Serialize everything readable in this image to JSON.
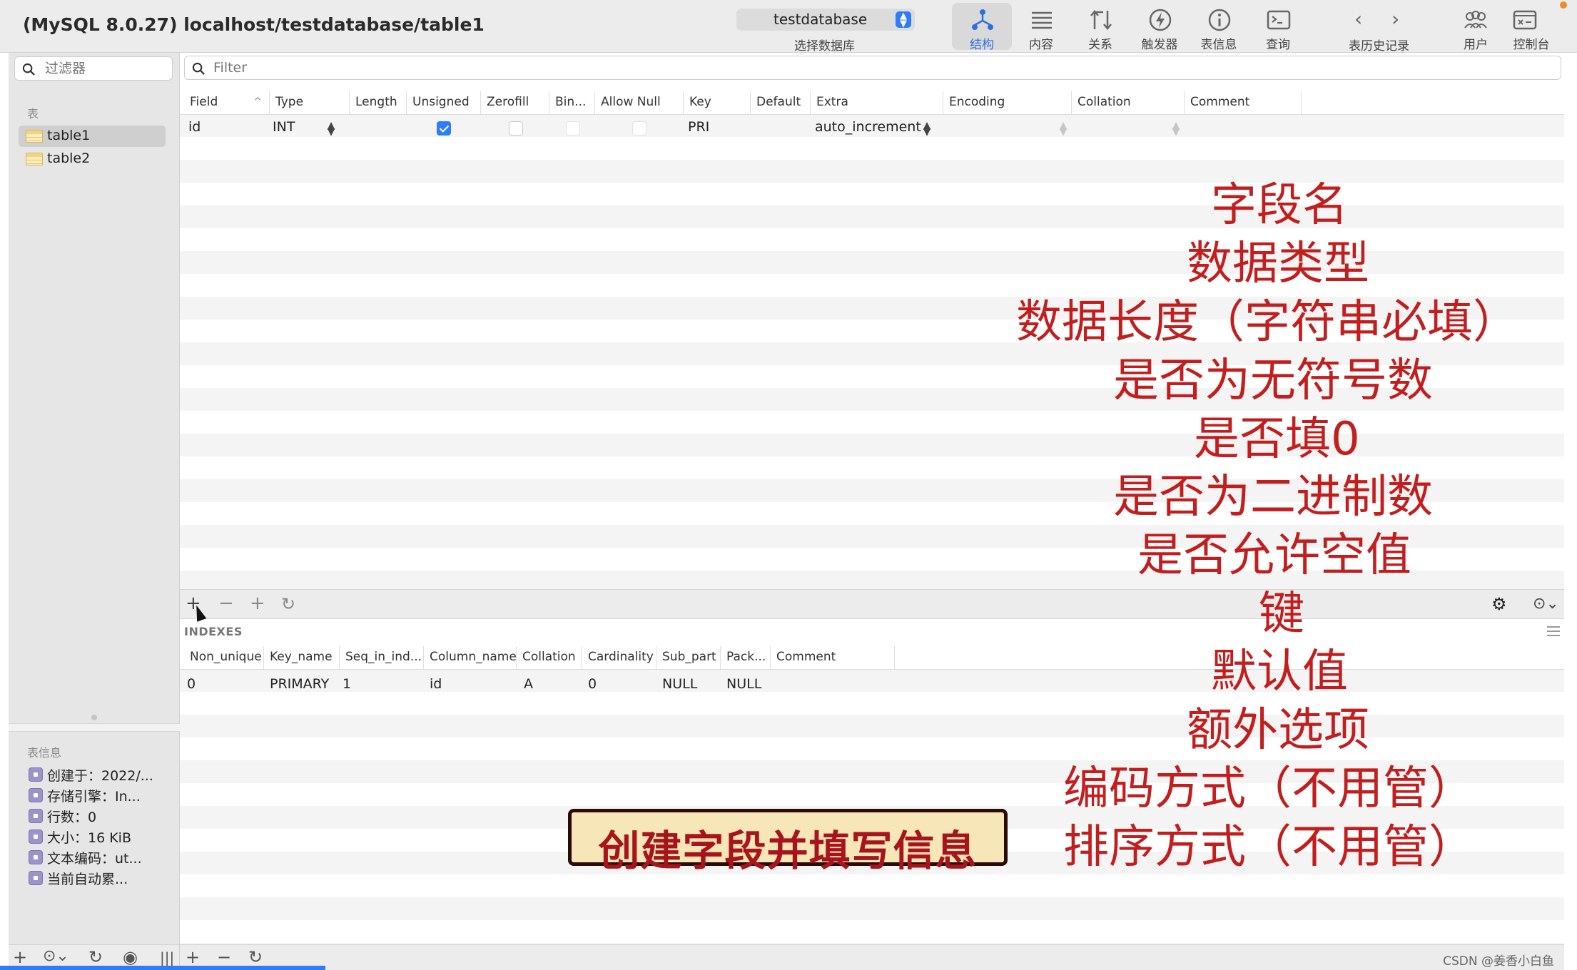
{
  "window": {
    "title": "(MySQL 8.0.27) localhost/testdatabase/table1"
  },
  "db_selector": {
    "value": "testdatabase",
    "caption": "选择数据库"
  },
  "toolbar": {
    "tools": [
      {
        "label": "结构",
        "icon": "structure-icon",
        "active": true
      },
      {
        "label": "内容",
        "icon": "content-icon"
      },
      {
        "label": "关系",
        "icon": "relations-icon"
      },
      {
        "label": "触发器",
        "icon": "triggers-icon"
      },
      {
        "label": "表信息",
        "icon": "table-info-icon"
      },
      {
        "label": "查询",
        "icon": "query-icon"
      }
    ],
    "history_label": "表历史记录",
    "users_label": "用户",
    "console_label": "控制台"
  },
  "sidebar": {
    "filter_placeholder": "过滤器",
    "tables_section": "表",
    "tables": [
      "table1",
      "table2"
    ],
    "info_section": "表信息",
    "info_items": [
      "创建于：2022/...",
      "存储引擎：In...",
      "行数：0",
      "大小：16 KiB",
      "文本编码：ut...",
      "当前自动累..."
    ]
  },
  "main": {
    "filter_placeholder": "Filter"
  },
  "structure_table": {
    "columns": [
      "Field",
      "Type",
      "Length",
      "Unsigned",
      "Zerofill",
      "Bin...",
      "Allow Null",
      "Key",
      "Default",
      "Extra",
      "Encoding",
      "Collation",
      "Comment"
    ],
    "rows": [
      {
        "field": "id",
        "type": "INT",
        "length": "",
        "unsigned": true,
        "zerofill": false,
        "binary": false,
        "allow_null": false,
        "key": "PRI",
        "default": "",
        "extra": "auto_increment",
        "encoding": "",
        "collation": "",
        "comment": ""
      }
    ]
  },
  "indexes": {
    "section_label": "INDEXES",
    "columns": [
      "Non_unique",
      "Key_name",
      "Seq_in_ind...",
      "Column_name",
      "Collation",
      "Cardinality",
      "Sub_part",
      "Pack...",
      "Comment"
    ],
    "rows": [
      [
        "0",
        "PRIMARY",
        "1",
        "id",
        "A",
        "0",
        "NULL",
        "NULL",
        ""
      ]
    ]
  },
  "annotations": [
    "字段名",
    "数据类型",
    "数据长度（字符串必填）",
    "是否为无符号数",
    "是否填0",
    "是否为二进制数",
    "是否允许空值",
    "键",
    "默认值",
    "额外选项",
    "编码方式（不用管）",
    "排序方式（不用管）"
  ],
  "caption": "创建字段并填写信息",
  "watermark": "CSDN @姜香小白鱼",
  "colors": {
    "accent": "#2f7cf6",
    "annotation_red": "#c21e1e",
    "banner_bg": "#f7e7b8"
  }
}
